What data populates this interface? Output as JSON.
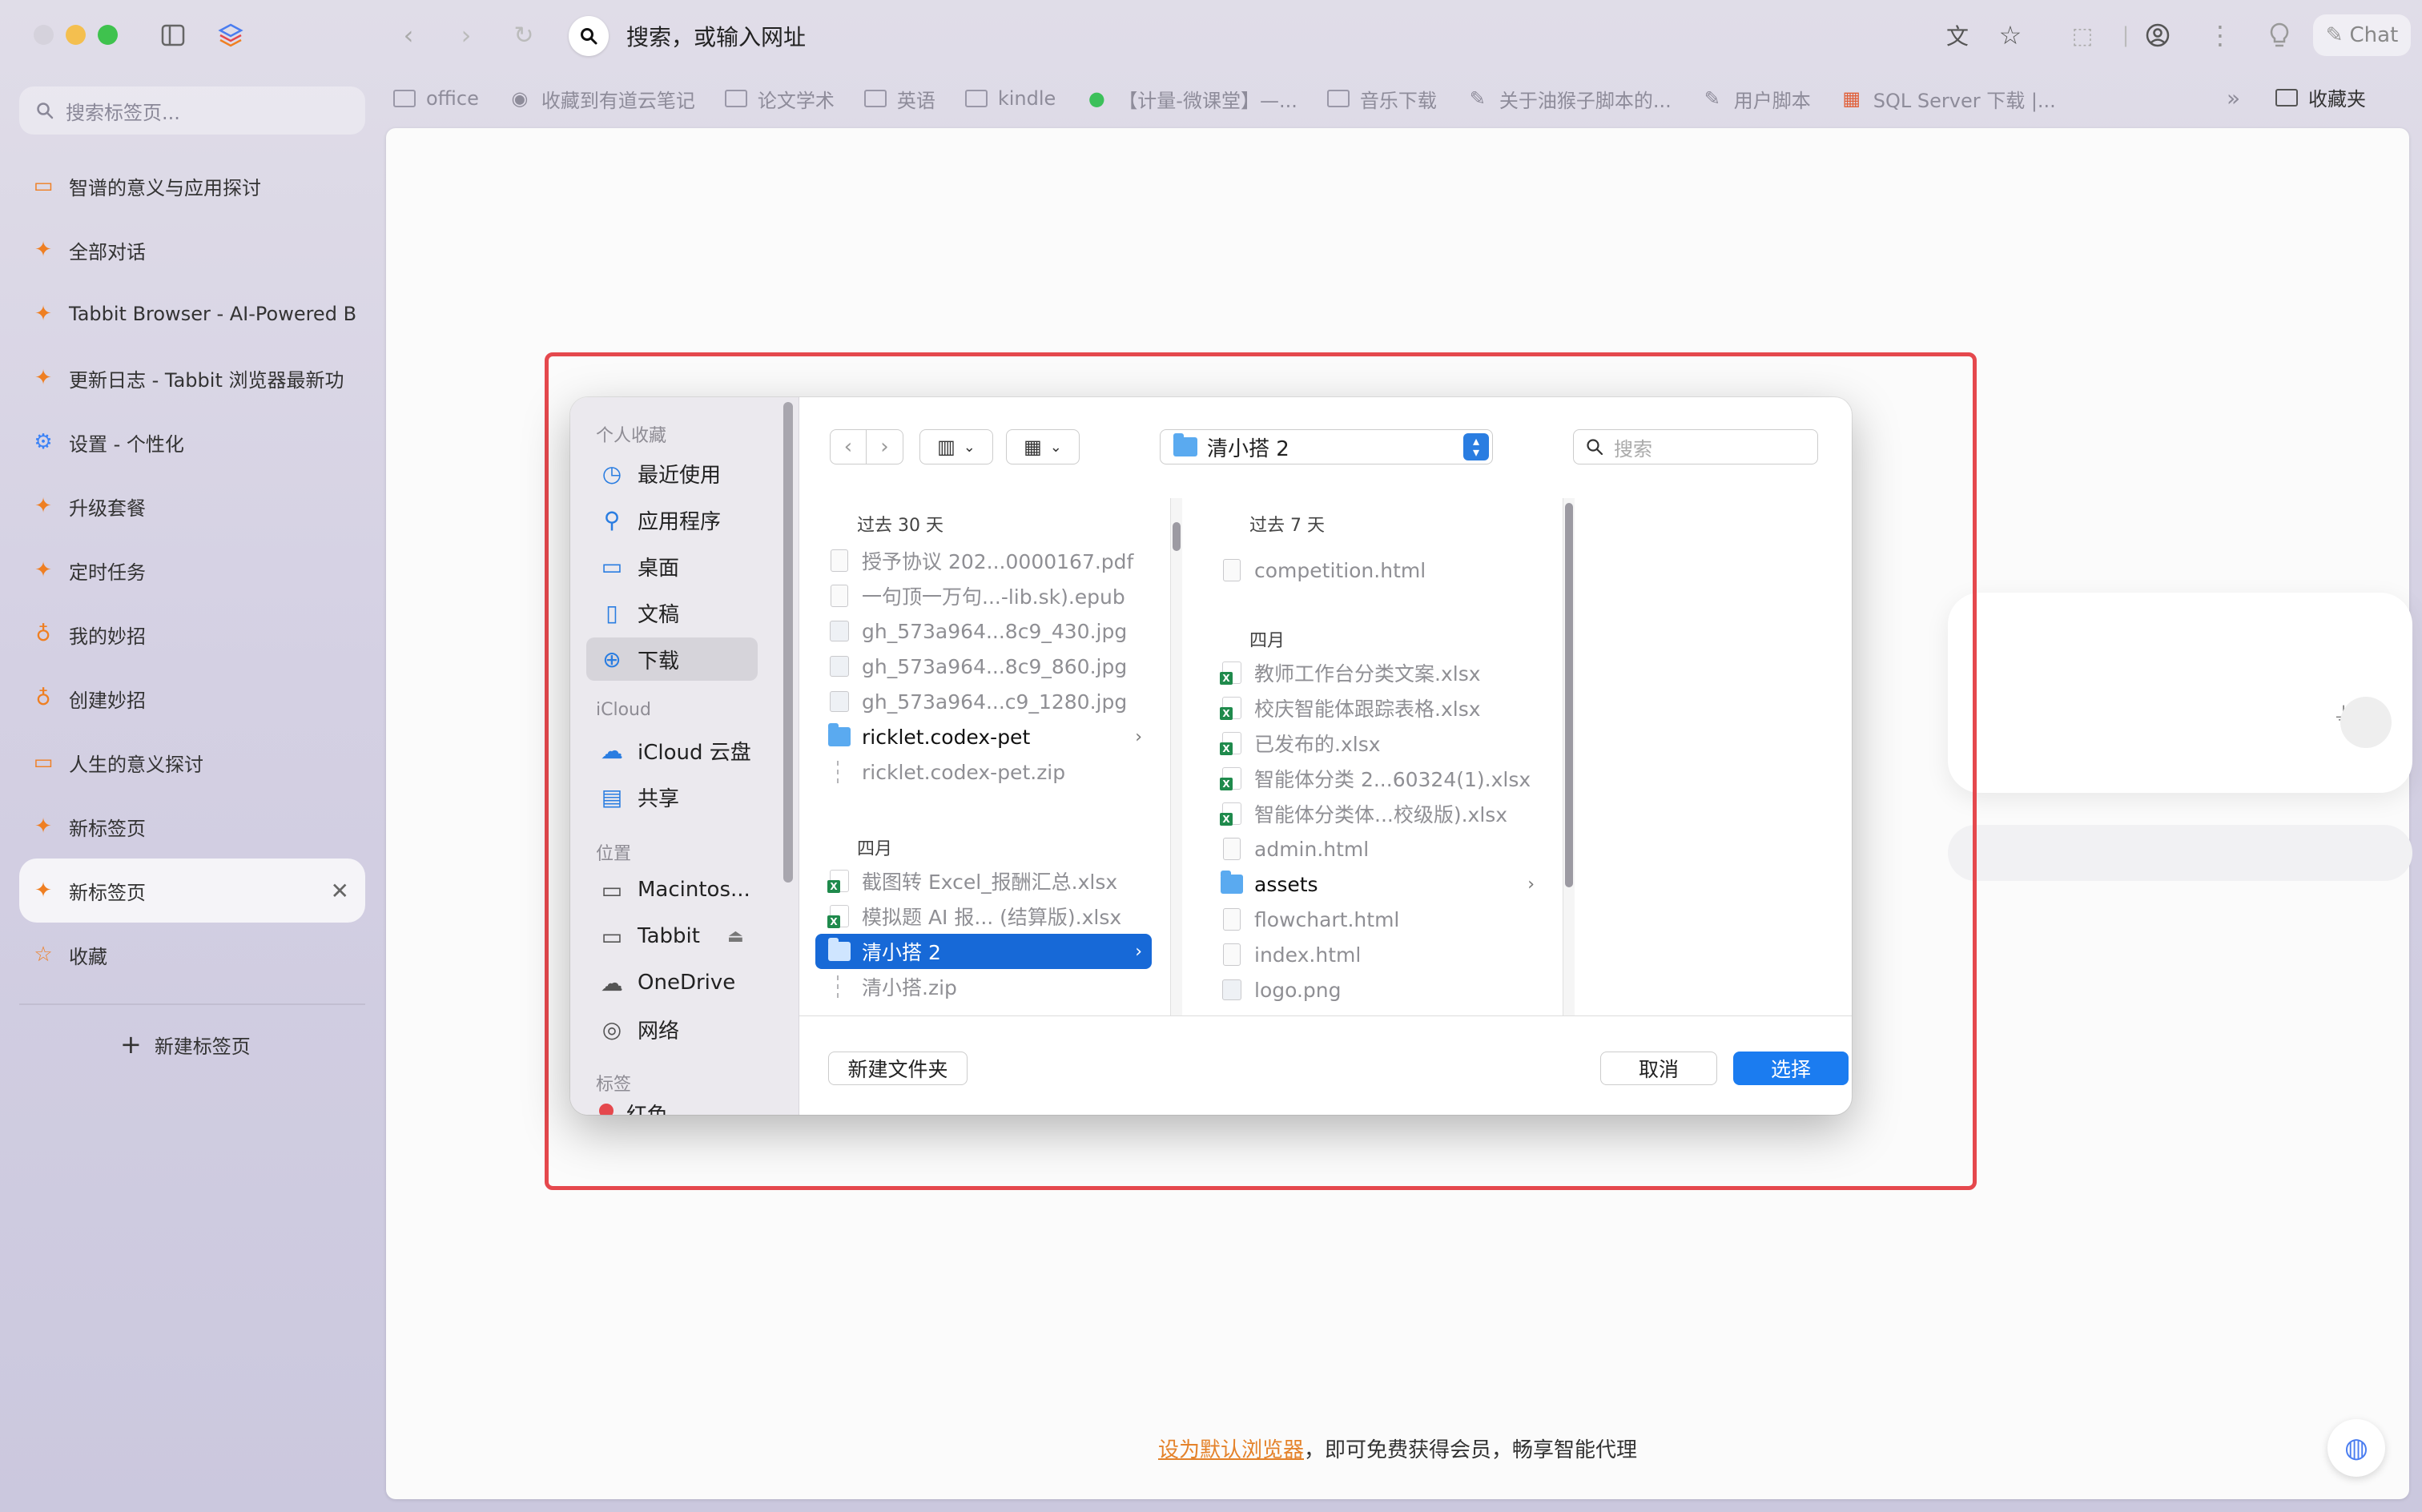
{
  "toolbar": {
    "address_placeholder": "搜索，或输入网址",
    "chat_label": "Chat"
  },
  "bookmarks": [
    {
      "label": "office",
      "icon": "folder-icon"
    },
    {
      "label": "收藏到有道云笔记",
      "icon": "globe-icon"
    },
    {
      "label": "论文学术",
      "icon": "folder-icon"
    },
    {
      "label": "英语",
      "icon": "folder-icon"
    },
    {
      "label": "kindle",
      "icon": "folder-icon"
    },
    {
      "label": "【计量-微课堂】—...",
      "icon": "wechat-icon"
    },
    {
      "label": "音乐下载",
      "icon": "folder-icon"
    },
    {
      "label": "关于油猴子脚本的...",
      "icon": "script-icon"
    },
    {
      "label": "用户脚本",
      "icon": "script-icon"
    },
    {
      "label": "SQL Server 下载 |...",
      "icon": "microsoft-icon"
    }
  ],
  "bookmarks_overflow": "»",
  "bookmarks_folder": "收藏夹",
  "sidebar": {
    "search_placeholder": "搜索标签页...",
    "tabs": [
      {
        "label": "智谱的意义与应用探讨",
        "icon": "chat-icon"
      },
      {
        "label": "全部对话",
        "icon": "tabbit-icon"
      },
      {
        "label": "Tabbit Browser - AI-Powered B",
        "icon": "tabbit-icon"
      },
      {
        "label": "更新日志 - Tabbit 浏览器最新功",
        "icon": "tabbit-icon"
      },
      {
        "label": "设置 - 个性化",
        "icon": "gear-icon"
      },
      {
        "label": "升级套餐",
        "icon": "tabbit-icon"
      },
      {
        "label": "定时任务",
        "icon": "tabbit-icon"
      },
      {
        "label": "我的妙招",
        "icon": "bulb-icon"
      },
      {
        "label": "创建妙招",
        "icon": "bulb-icon"
      },
      {
        "label": "人生的意义探讨",
        "icon": "chat-icon"
      },
      {
        "label": "新标签页",
        "icon": "tabbit-icon"
      },
      {
        "label": "新标签页",
        "icon": "tabbit-icon",
        "active": true
      },
      {
        "label": "收藏",
        "icon": "star-icon"
      }
    ],
    "new_tab_label": "新建标签页"
  },
  "page": {
    "bottom_link": "设为默认浏览器",
    "bottom_text": "，即可免费获得会员，畅享智能代理"
  },
  "dialog": {
    "sidebar": {
      "section_personal": "个人收藏",
      "personal": [
        {
          "label": "最近使用",
          "icon": "clock-icon"
        },
        {
          "label": "应用程序",
          "icon": "apps-icon"
        },
        {
          "label": "桌面",
          "icon": "desktop-icon"
        },
        {
          "label": "文稿",
          "icon": "document-icon"
        },
        {
          "label": "下载",
          "icon": "download-icon",
          "selected": true
        }
      ],
      "section_icloud": "iCloud",
      "icloud": [
        {
          "label": "iCloud 云盘",
          "icon": "cloud-icon"
        },
        {
          "label": "共享",
          "icon": "shared-folder-icon"
        }
      ],
      "section_locations": "位置",
      "locations": [
        {
          "label": "Macintos...",
          "icon": "disk-icon"
        },
        {
          "label": "Tabbit",
          "icon": "disk-icon"
        },
        {
          "label": "OneDrive",
          "icon": "cloud-icon"
        },
        {
          "label": "网络",
          "icon": "network-icon"
        }
      ],
      "section_tags": "标签",
      "tag_partial": "红色"
    },
    "path": "清小搭 2",
    "search_placeholder": "搜索",
    "column1": {
      "group1": "过去 30 天",
      "group1_items": [
        {
          "name": "授予协议 202...0000167.pdf",
          "type": "file"
        },
        {
          "name": "一句顶一万句...-lib.sk).epub",
          "type": "file"
        },
        {
          "name": "gh_573a964...8c9_430.jpg",
          "type": "img"
        },
        {
          "name": "gh_573a964...8c9_860.jpg",
          "type": "img"
        },
        {
          "name": "gh_573a964...c9_1280.jpg",
          "type": "img"
        },
        {
          "name": "ricklet.codex-pet",
          "type": "folder"
        },
        {
          "name": "ricklet.codex-pet.zip",
          "type": "zip"
        }
      ],
      "group2": "四月",
      "group2_items": [
        {
          "name": "截图转 Excel_报酬汇总.xlsx",
          "type": "xlsx"
        },
        {
          "name": "模拟题 AI 报... (结算版).xlsx",
          "type": "xlsx"
        },
        {
          "name": "清小搭 2",
          "type": "folder",
          "selected": true
        },
        {
          "name": "清小搭.zip",
          "type": "zip"
        }
      ]
    },
    "column2": {
      "group1": "过去 7 天",
      "group1_items": [
        {
          "name": "competition.html",
          "type": "file"
        }
      ],
      "group2": "四月",
      "group2_items": [
        {
          "name": "教师工作台分类文案.xlsx",
          "type": "xlsx"
        },
        {
          "name": "校庆智能体跟踪表格.xlsx",
          "type": "xlsx"
        },
        {
          "name": "已发布的.xlsx",
          "type": "xlsx"
        },
        {
          "name": "智能体分类 2...60324(1).xlsx",
          "type": "xlsx"
        },
        {
          "name": "智能体分类体...校级版).xlsx",
          "type": "xlsx"
        },
        {
          "name": "admin.html",
          "type": "file"
        },
        {
          "name": "assets",
          "type": "folder"
        },
        {
          "name": "flowchart.html",
          "type": "file"
        },
        {
          "name": "index.html",
          "type": "file"
        },
        {
          "name": "logo.png",
          "type": "img"
        }
      ]
    },
    "buttons": {
      "new_folder": "新建文件夹",
      "cancel": "取消",
      "choose": "选择"
    }
  }
}
